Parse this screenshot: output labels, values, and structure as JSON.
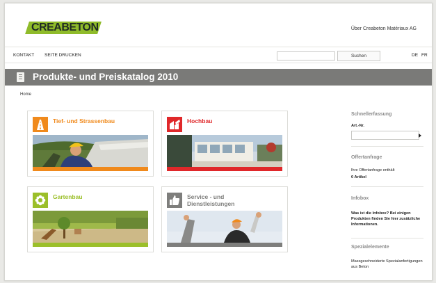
{
  "header": {
    "logo_text": "CREABETON",
    "about_link": "Über Creabeton Matériaux AG"
  },
  "nav": {
    "contact": "KONTAKT",
    "print": "SEITE DRUCKEN",
    "search_button": "Suchen",
    "search_placeholder": "",
    "lang_de": "DE",
    "lang_fr": "FR"
  },
  "banner": {
    "title": "Produkte- und Preiskatalog 2010"
  },
  "breadcrumb": {
    "home": "Home"
  },
  "categories": [
    {
      "title": "Tief- und Strassenbau",
      "color": "#f08a1c"
    },
    {
      "title": "Hochbau",
      "color": "#e0282a"
    },
    {
      "title": "Gartenbau",
      "color": "#9bbf2a"
    },
    {
      "title": "Service - und Dienstleistungen",
      "color": "#7e7e7c"
    }
  ],
  "sidebar": {
    "quick_title": "Schnellerfassung",
    "article_label": "Art.-Nr.",
    "offer_title": "Offertanfrage",
    "offer_text": "Ihre Offertanfrage enthält",
    "offer_count": "0 Artikel",
    "infobox_title": "Infobox",
    "infobox_text": "Was ist die Infobox? Bei einigen Produkten finden Sie hier zusätzliche Informationen.",
    "special_title": "Spezialelemente",
    "special_text": "Massgeschneiderte Spezialanfertigungen aus Beton"
  }
}
